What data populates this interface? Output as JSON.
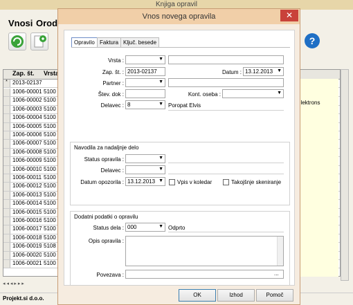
{
  "main": {
    "title": "Knjiga opravil",
    "menu": [
      "Vnosi",
      "Orod"
    ],
    "table_headers": [
      "Zap. št.",
      "Vrsta"
    ],
    "new_row": {
      "marker": "*",
      "zap": "2013-02137"
    },
    "rows": [
      {
        "zap": "1006-00001",
        "vrsta": "5100"
      },
      {
        "zap": "1006-00002",
        "vrsta": "5100"
      },
      {
        "zap": "1006-00003",
        "vrsta": "5100"
      },
      {
        "zap": "1006-00004",
        "vrsta": "5100"
      },
      {
        "zap": "1006-00005",
        "vrsta": "5100"
      },
      {
        "zap": "1006-00006",
        "vrsta": "5100"
      },
      {
        "zap": "1006-00007",
        "vrsta": "5100"
      },
      {
        "zap": "1006-00008",
        "vrsta": "5100"
      },
      {
        "zap": "1006-00009",
        "vrsta": "5100"
      },
      {
        "zap": "1006-00010",
        "vrsta": "5100"
      },
      {
        "zap": "1006-00011",
        "vrsta": "5100"
      },
      {
        "zap": "1006-00012",
        "vrsta": "5100"
      },
      {
        "zap": "1006-00013",
        "vrsta": "5100"
      },
      {
        "zap": "1006-00014",
        "vrsta": "5100"
      },
      {
        "zap": "1006-00015",
        "vrsta": "5100"
      },
      {
        "zap": "1006-00016",
        "vrsta": "5100"
      },
      {
        "zap": "1006-00017",
        "vrsta": "5100"
      },
      {
        "zap": "1006-00018",
        "vrsta": "5100"
      },
      {
        "zap": "1006-00019",
        "vrsta": "5108"
      },
      {
        "zap": "1006-00020",
        "vrsta": "5100"
      },
      {
        "zap": "1006-00021",
        "vrsta": "5100"
      }
    ],
    "right_text": "elektrons",
    "status": "Projekt.si d.o.o."
  },
  "dialog": {
    "title": "Vnos novega opravila",
    "close": "✕",
    "tabs": [
      "Opravilo",
      "Faktura",
      "Ključ. besede"
    ],
    "vrsta_label": "Vrsta :",
    "zap_label": "Zap. št. :",
    "zap_value": "2013-02137",
    "datum_label": "Datum :",
    "datum_value": "13.12.2013",
    "partner_label": "Partner :",
    "stev_dok_label": "Štev. dok :",
    "kont_oseba_label": "Kont. oseba :",
    "delavec_label": "Delavec :",
    "delavec_value": "8",
    "delavec_name": "Poropat Elvis",
    "nav_section_title": "Navodila za nadaljnje delo",
    "status_opravila_label": "Status opravila :",
    "nav_delavec_label": "Delavec :",
    "datum_opozorila_label": "Datum opozorila :",
    "datum_opozorila_value": "13.12.2013",
    "vpis_koledar": "Vpis v koledar",
    "skeniranje": "Takojšnje skeniranje",
    "dodatni_title": "Dodatni podatki o opravilu",
    "status_dela_label": "Status dela :",
    "status_dela_value": "000",
    "status_dela_text": "Odprto",
    "opis_label": "Opis opravila :",
    "povezava_label": "Povezava :",
    "povezava_btn": "...",
    "ok": "OK",
    "izhod": "Izhod",
    "pomoc": "Pomoč"
  }
}
